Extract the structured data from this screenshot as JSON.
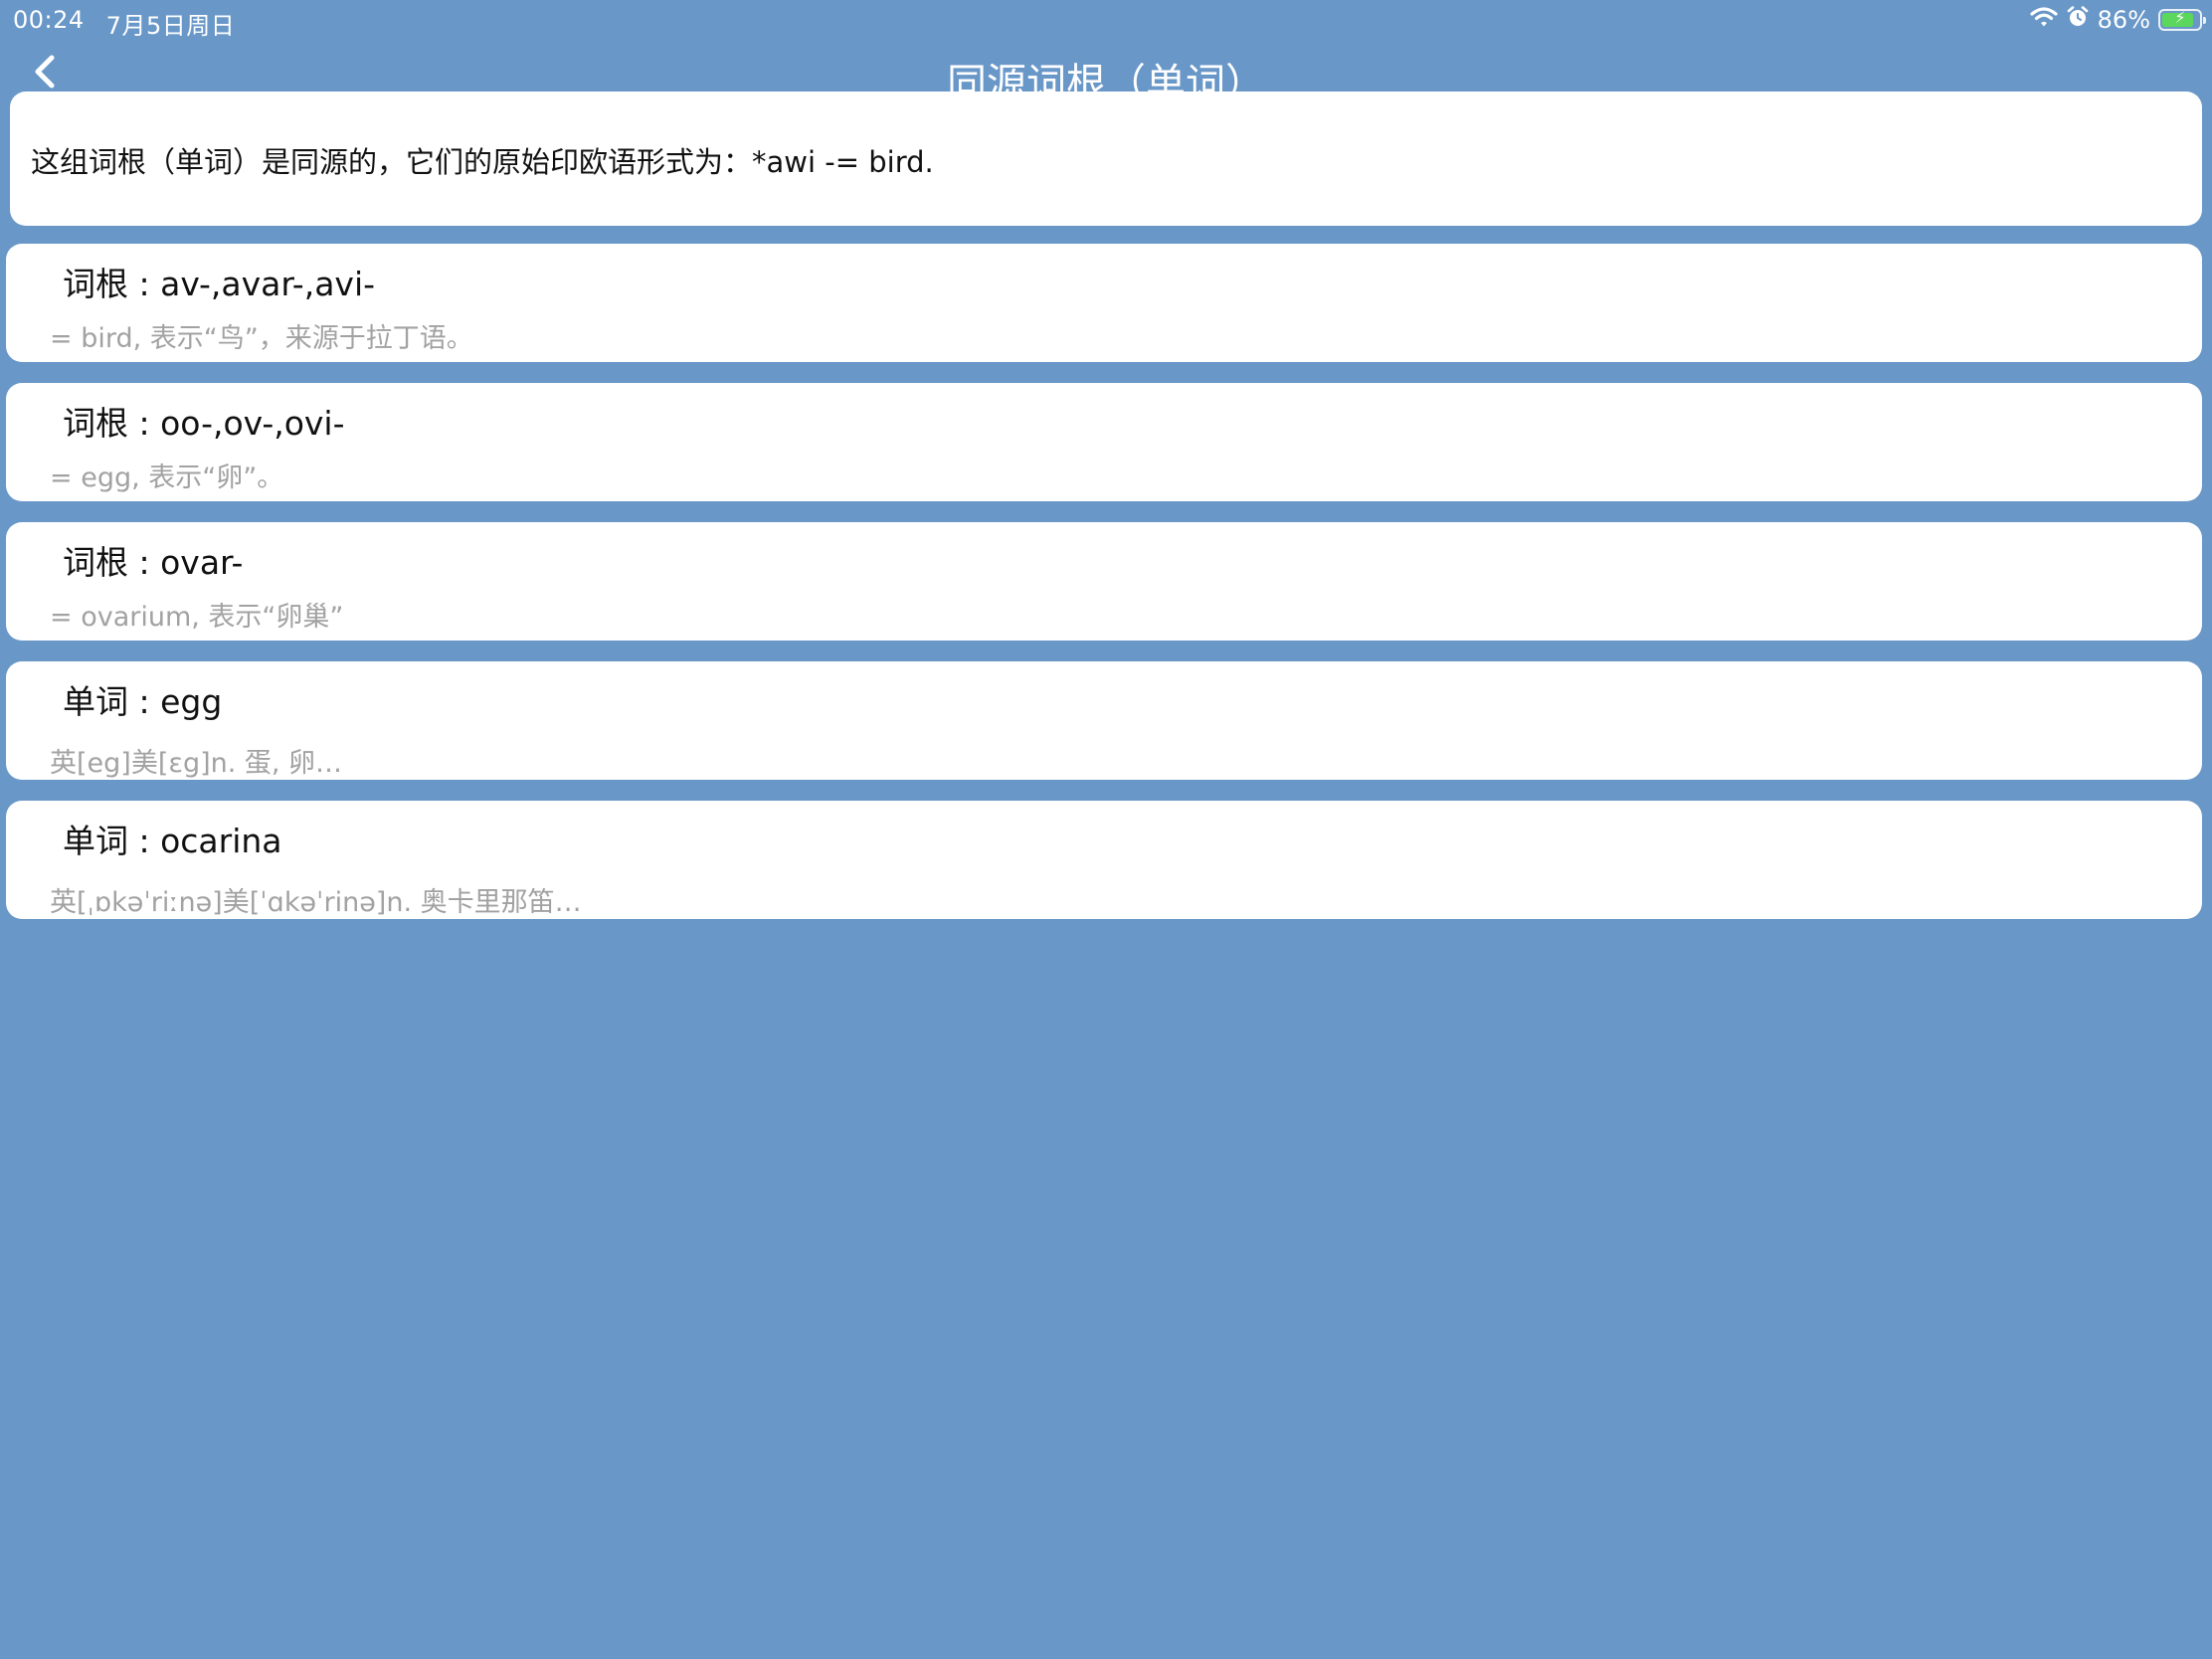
{
  "status_bar": {
    "time": "00:24",
    "date": "7月5日周日",
    "battery_percent": "86%",
    "battery_level": 0.86,
    "icons": [
      "wifi-icon",
      "alarm-icon",
      "battery-charging-icon"
    ]
  },
  "nav": {
    "title": "同源词根（单词）",
    "back_icon": "chevron-left-icon"
  },
  "intro": {
    "text": "这组词根（单词）是同源的，它们的原始印欧语形式为：*awi -= bird."
  },
  "entries": [
    {
      "title": "词根 : av-,avar-,avi-",
      "subtitle": "= bird, 表示“鸟”，来源于拉丁语。"
    },
    {
      "title": "词根 : oo-,ov-,ovi-",
      "subtitle": "= egg, 表示“卵”。"
    },
    {
      "title": "词根 : ovar-",
      "subtitle": "= ovarium, 表示“卵巢”"
    },
    {
      "title": "单词 : egg",
      "subtitle": "英[eg]美[ɛg]n. 蛋, 卵…"
    },
    {
      "title": "单词 : ocarina",
      "subtitle": "英[ˌɒkəˈriːnə]美[ˈɑkəˈrinə]n. 奥卡里那笛…"
    }
  ],
  "colors": {
    "background": "#6897c8",
    "card": "#ffffff",
    "subtitle_text": "#a2a2a2",
    "battery_fill": "#5bd85b"
  }
}
